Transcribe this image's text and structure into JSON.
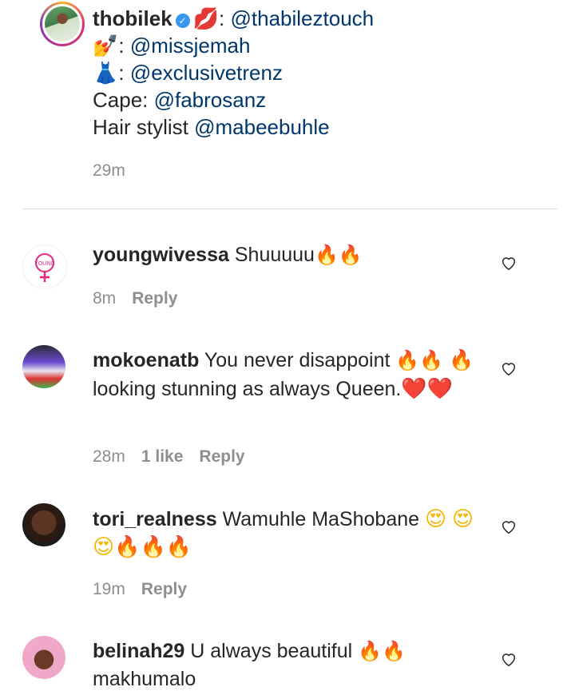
{
  "caption": {
    "username": "thobilek",
    "lines": [
      {
        "prefix": "💋: ",
        "mention": "@thabileztouch"
      },
      {
        "prefix": "💅: ",
        "mention": "@missjemah"
      },
      {
        "prefix": "👗: ",
        "mention": "@exclusivetrenz"
      },
      {
        "prefix": "Cape: ",
        "mention": "@fabrosanz"
      },
      {
        "prefix": "Hair stylist ",
        "mention": "@mabeebuhle"
      }
    ],
    "time": "29m"
  },
  "comments": [
    {
      "username": "youngwivessa",
      "text": "Shuuuuu",
      "emojis": "🔥🔥",
      "time": "8m",
      "likes": "",
      "reply": "Reply"
    },
    {
      "username": "mokoenatb",
      "text": "You never disappoint",
      "emojis": "🔥🔥",
      "text2": "🔥looking stunning as always Queen.",
      "emojis2": "❤️❤️",
      "time": "28m",
      "likes": "1 like",
      "reply": "Reply"
    },
    {
      "username": "tori_realness",
      "text": "Wamuhle MaShobane",
      "emojis": "😍",
      "emojis2": "😍😍🔥🔥🔥",
      "time": "19m",
      "likes": "",
      "reply": "Reply"
    },
    {
      "username": "belinah29",
      "text": "U always beautiful",
      "emojis": "🔥🔥",
      "text2": "makhumalo"
    }
  ],
  "colors": {
    "mention": "#00376b",
    "secondary_text": "#8e8e8e",
    "verified_badge": "#3897f0",
    "divider": "#dbdbdb"
  },
  "icons": [
    "verified-badge-icon",
    "heart-outline-icon"
  ]
}
